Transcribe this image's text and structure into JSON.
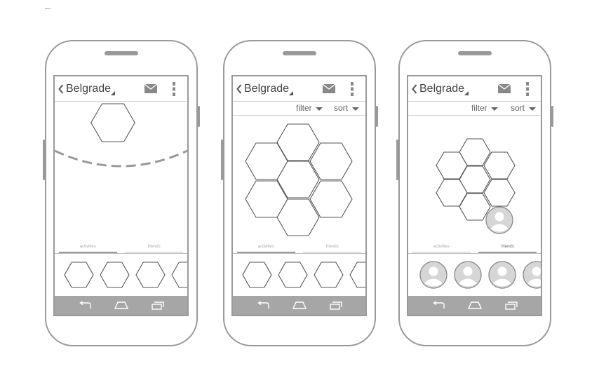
{
  "screens": [
    {
      "city": "Belgrade",
      "filter_label": "",
      "sort_label": "",
      "tab_activities": "activities",
      "tab_friends": "friends",
      "active_tab": "activities"
    },
    {
      "city": "Belgrade",
      "filter_label": "filter",
      "sort_label": "sort",
      "tab_activities": "activities",
      "tab_friends": "friends",
      "active_tab": "activities"
    },
    {
      "city": "Belgrade",
      "filter_label": "filter",
      "sort_label": "sort",
      "tab_activities": "activities",
      "tab_friends": "friends",
      "active_tab": "friends"
    }
  ],
  "icons": {
    "back": "chevron-left-icon",
    "spinner": "dropdown-triangle-icon",
    "mail": "mail-icon",
    "menu": "overflow-menu-icon",
    "nav_back": "nav-back-icon",
    "nav_home": "nav-home-icon",
    "nav_recent": "nav-recent-apps-icon",
    "activity": "hexagon-icon",
    "friend": "avatar-icon"
  },
  "colors": {
    "outline": "#999999",
    "navbar": "#a6a6a6",
    "avatar_fill": "#d6d6d6"
  }
}
